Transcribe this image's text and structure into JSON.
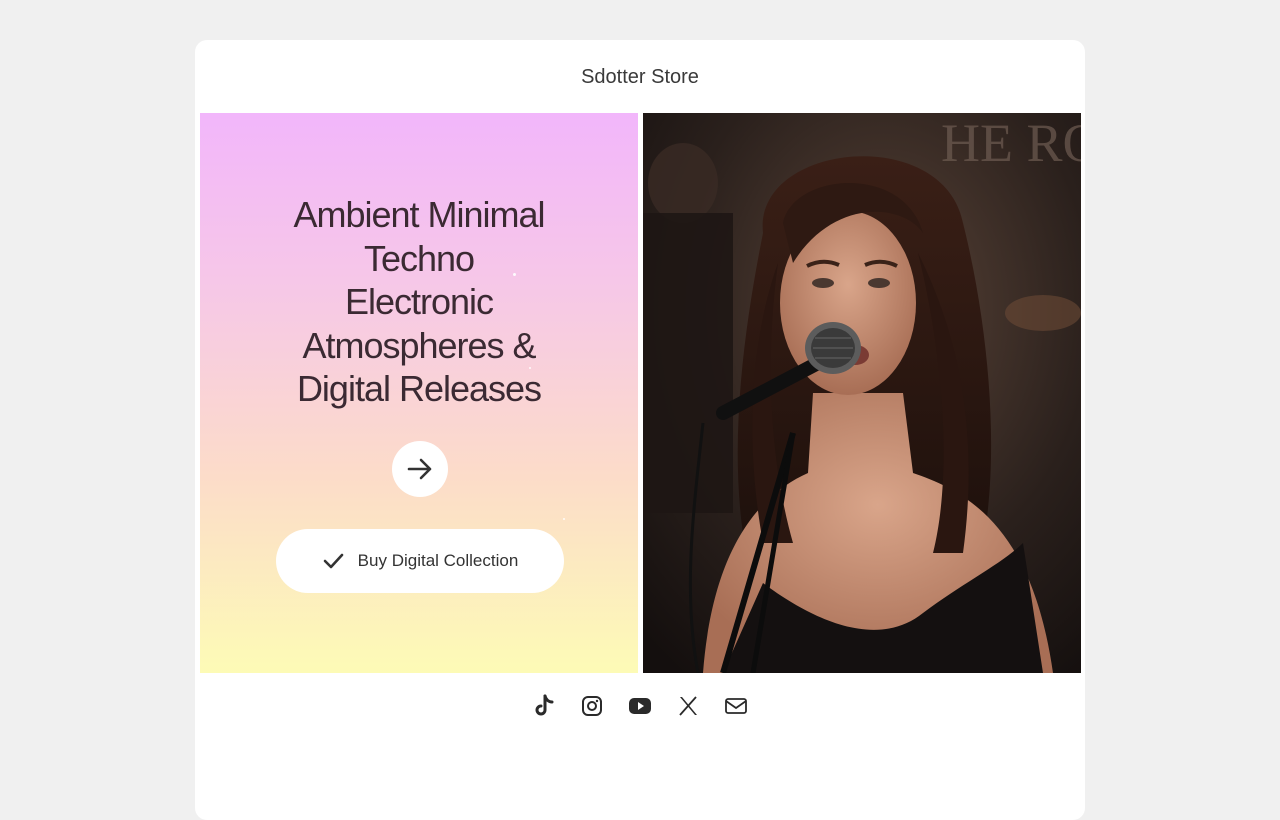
{
  "store": {
    "title": "Sdotter Store"
  },
  "hero": {
    "headline_lines": [
      "Ambient Minimal",
      "Techno",
      "Electronic",
      "Atmospheres &",
      "Digital Releases"
    ],
    "arrow_icon": "arrow-right-icon",
    "buy_button_label": "Buy Digital Collection",
    "buy_button_icon": "checkmark-icon",
    "gradient_colors": [
      "#f2b6fb",
      "#f6c7e8",
      "#fcdcc9",
      "#fdfbb6"
    ]
  },
  "photo": {
    "subject": "singer-at-microphone-image"
  },
  "socials": [
    {
      "icon": "tiktok-icon"
    },
    {
      "icon": "instagram-icon"
    },
    {
      "icon": "youtube-icon"
    },
    {
      "icon": "x-icon"
    },
    {
      "icon": "mail-icon"
    }
  ],
  "colors": {
    "page_bg": "#f0f0f0",
    "card_bg": "#ffffff",
    "text_dark": "#3b2a33",
    "icon_color": "#2a2a2a"
  }
}
